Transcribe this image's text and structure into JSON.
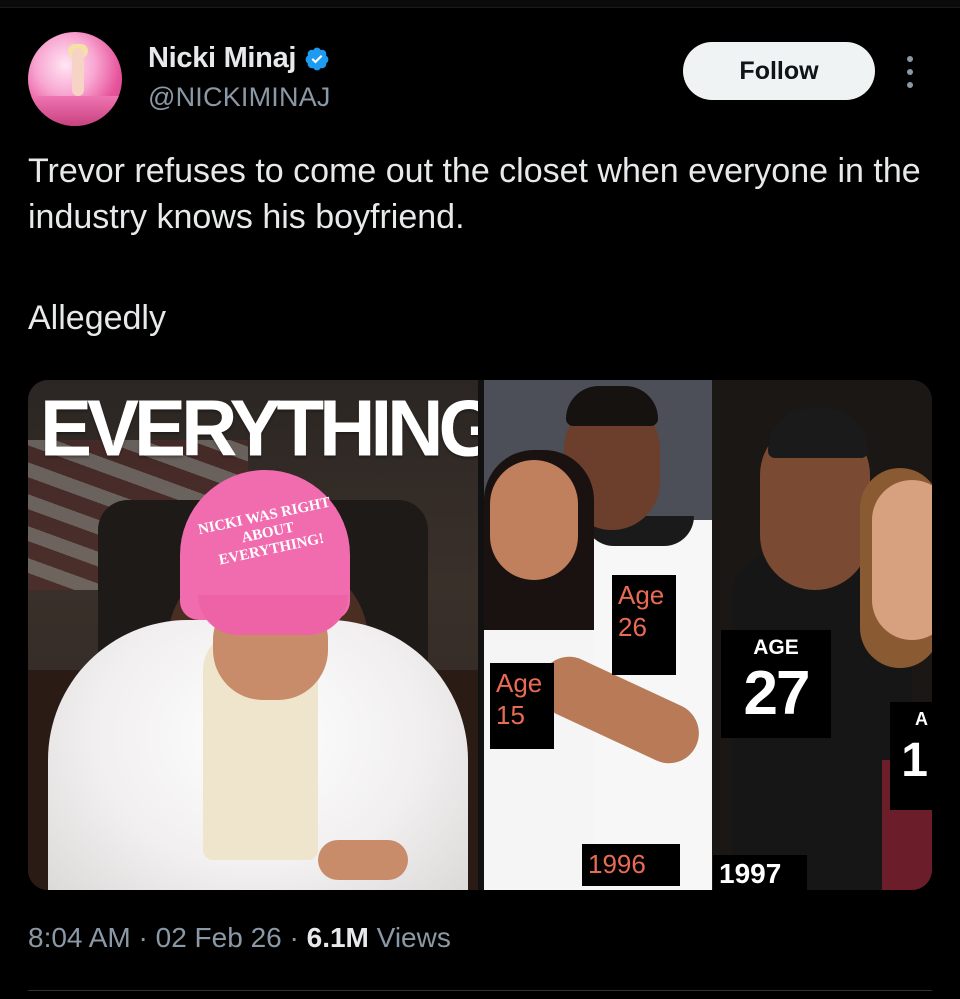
{
  "tweet": {
    "author": {
      "display_name": "Nicki Minaj",
      "handle": "@NICKIMINAJ",
      "verified": true
    },
    "follow_label": "Follow",
    "text_lines": [
      "Trevor refuses to come out the closet when everyone in the industry knows his boyfriend.",
      "Allegedly"
    ],
    "media": {
      "headline": "EVERYTHING",
      "cap_text": "NICKI WAS RIGHT ABOUT EVERYTHING!",
      "labels": {
        "age26_word": "Age",
        "age26_num": "26",
        "age15_word": "Age",
        "age15_num": "15",
        "year_1996": "1996",
        "age27_word": "AGE",
        "age27_num": "27",
        "year_1997": "1997",
        "partial_word": "A",
        "partial_num": "1"
      }
    },
    "meta": {
      "time": "8:04 AM",
      "sep1": " · ",
      "date": "02 Feb 26",
      "sep2": " · ",
      "views_count": "6.1M",
      "views_label": " Views"
    }
  },
  "colors": {
    "background": "#000000",
    "text_primary": "#e7e9ea",
    "text_secondary": "#8b98a5",
    "verified_blue": "#1d9bf0",
    "follow_bg": "#eff3f4",
    "label_orange": "#e96a55"
  }
}
